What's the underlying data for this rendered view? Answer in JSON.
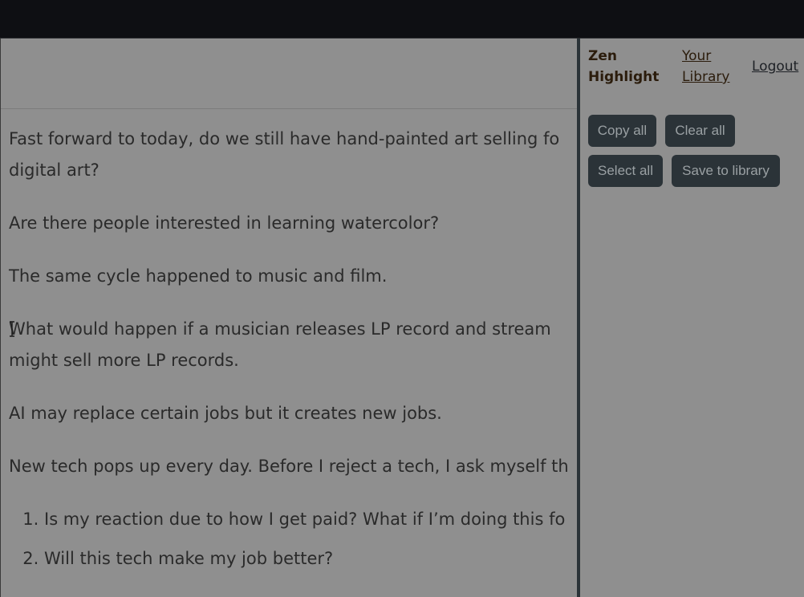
{
  "article": {
    "paragraphs": [
      "Fast forward to today, do we still have hand-painted art selling fo",
      "digital art?",
      "Are there people interested in learning watercolor?",
      "The same cycle happened to music and film.",
      "What would happen if a musician releases LP record and stream",
      "might sell more LP records.",
      "AI may replace certain jobs but it creates new jobs.",
      "New tech pops up every day. Before I reject a tech, I ask myself th"
    ],
    "list": [
      "Is my reaction due to how I get paid? What if I’m doing this fo",
      "Will this tech make my job better?"
    ]
  },
  "sidebar": {
    "brand": "Zen Highlight",
    "library_link": "Your Library",
    "logout_link": "Logout",
    "buttons": {
      "copy_all": "Copy all",
      "clear_all": "Clear all",
      "select_all": "Select all",
      "save_to_library": "Save to library"
    }
  },
  "colors": {
    "overlay_bg": "#8f8f8f",
    "topbar": "#0e0f13",
    "button_bg": "#2b3338",
    "button_text": "#9aa0a3",
    "brand_text": "#2b1c0c"
  }
}
